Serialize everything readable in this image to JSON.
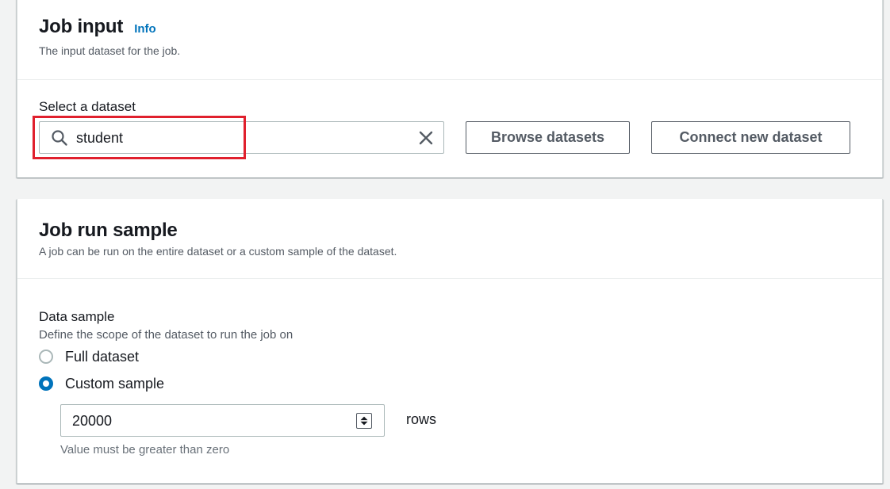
{
  "job_input": {
    "title": "Job input",
    "info_link": "Info",
    "description": "The input dataset for the job.",
    "select_label": "Select a dataset",
    "search": {
      "value": "student"
    },
    "browse_button": "Browse datasets",
    "connect_button": "Connect new dataset"
  },
  "job_run_sample": {
    "title": "Job run sample",
    "description": "A job can be run on the entire dataset or a custom sample of the dataset.",
    "data_sample_label": "Data sample",
    "data_sample_description": "Define the scope of the dataset to run the job on",
    "options": [
      {
        "label": "Full dataset",
        "selected": false
      },
      {
        "label": "Custom sample",
        "selected": true
      }
    ],
    "sample_size": "20000",
    "unit": "rows",
    "hint": "Value must be greater than zero"
  },
  "colors": {
    "accent": "#0073bb",
    "highlight": "#e0202d",
    "background": "#f2f3f3"
  },
  "icons": [
    "search-icon",
    "clear-icon",
    "spinner-icon"
  ]
}
